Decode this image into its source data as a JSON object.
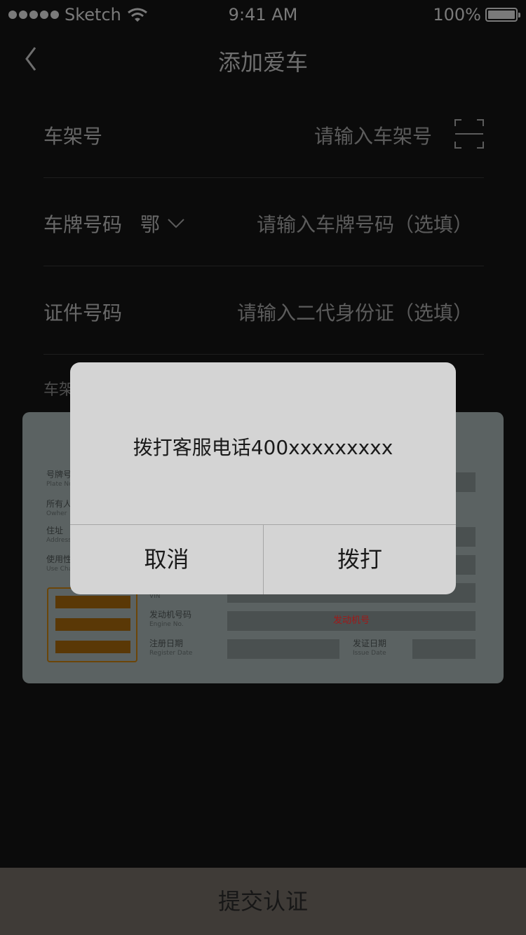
{
  "status_bar": {
    "carrier": "Sketch",
    "time": "9:41 AM",
    "battery": "100%"
  },
  "nav": {
    "title": "添加爱车"
  },
  "form": {
    "vin": {
      "label": "车架号",
      "placeholder": "请输入车架号"
    },
    "plate": {
      "label": "车牌号码",
      "region": "鄂",
      "placeholder": "请输入车牌号码（选填）"
    },
    "id": {
      "label": "证件号码",
      "placeholder": "请输入二代身份证（选填）"
    },
    "hint": "车架"
  },
  "card": {
    "fields": [
      {
        "cn": "号牌号",
        "en": "Plate No"
      },
      {
        "cn": "所有人",
        "en": "Owher"
      },
      {
        "cn": "住址",
        "en": "Address"
      },
      {
        "cn": "使用性",
        "en": "Use Cha"
      },
      {
        "cn": "",
        "en": "VIN"
      },
      {
        "cn": "发动机号码",
        "en": "Engine No."
      },
      {
        "cn": "注册日期",
        "en": "Register Date"
      },
      {
        "cn": "发证日期",
        "en": "Issue Date"
      }
    ],
    "engine_highlight": "发动机号"
  },
  "submit_label": "提交认证",
  "alert": {
    "message": "拨打客服电话400xxxxxxxxx",
    "cancel_label": "取消",
    "confirm_label": "拨打"
  }
}
